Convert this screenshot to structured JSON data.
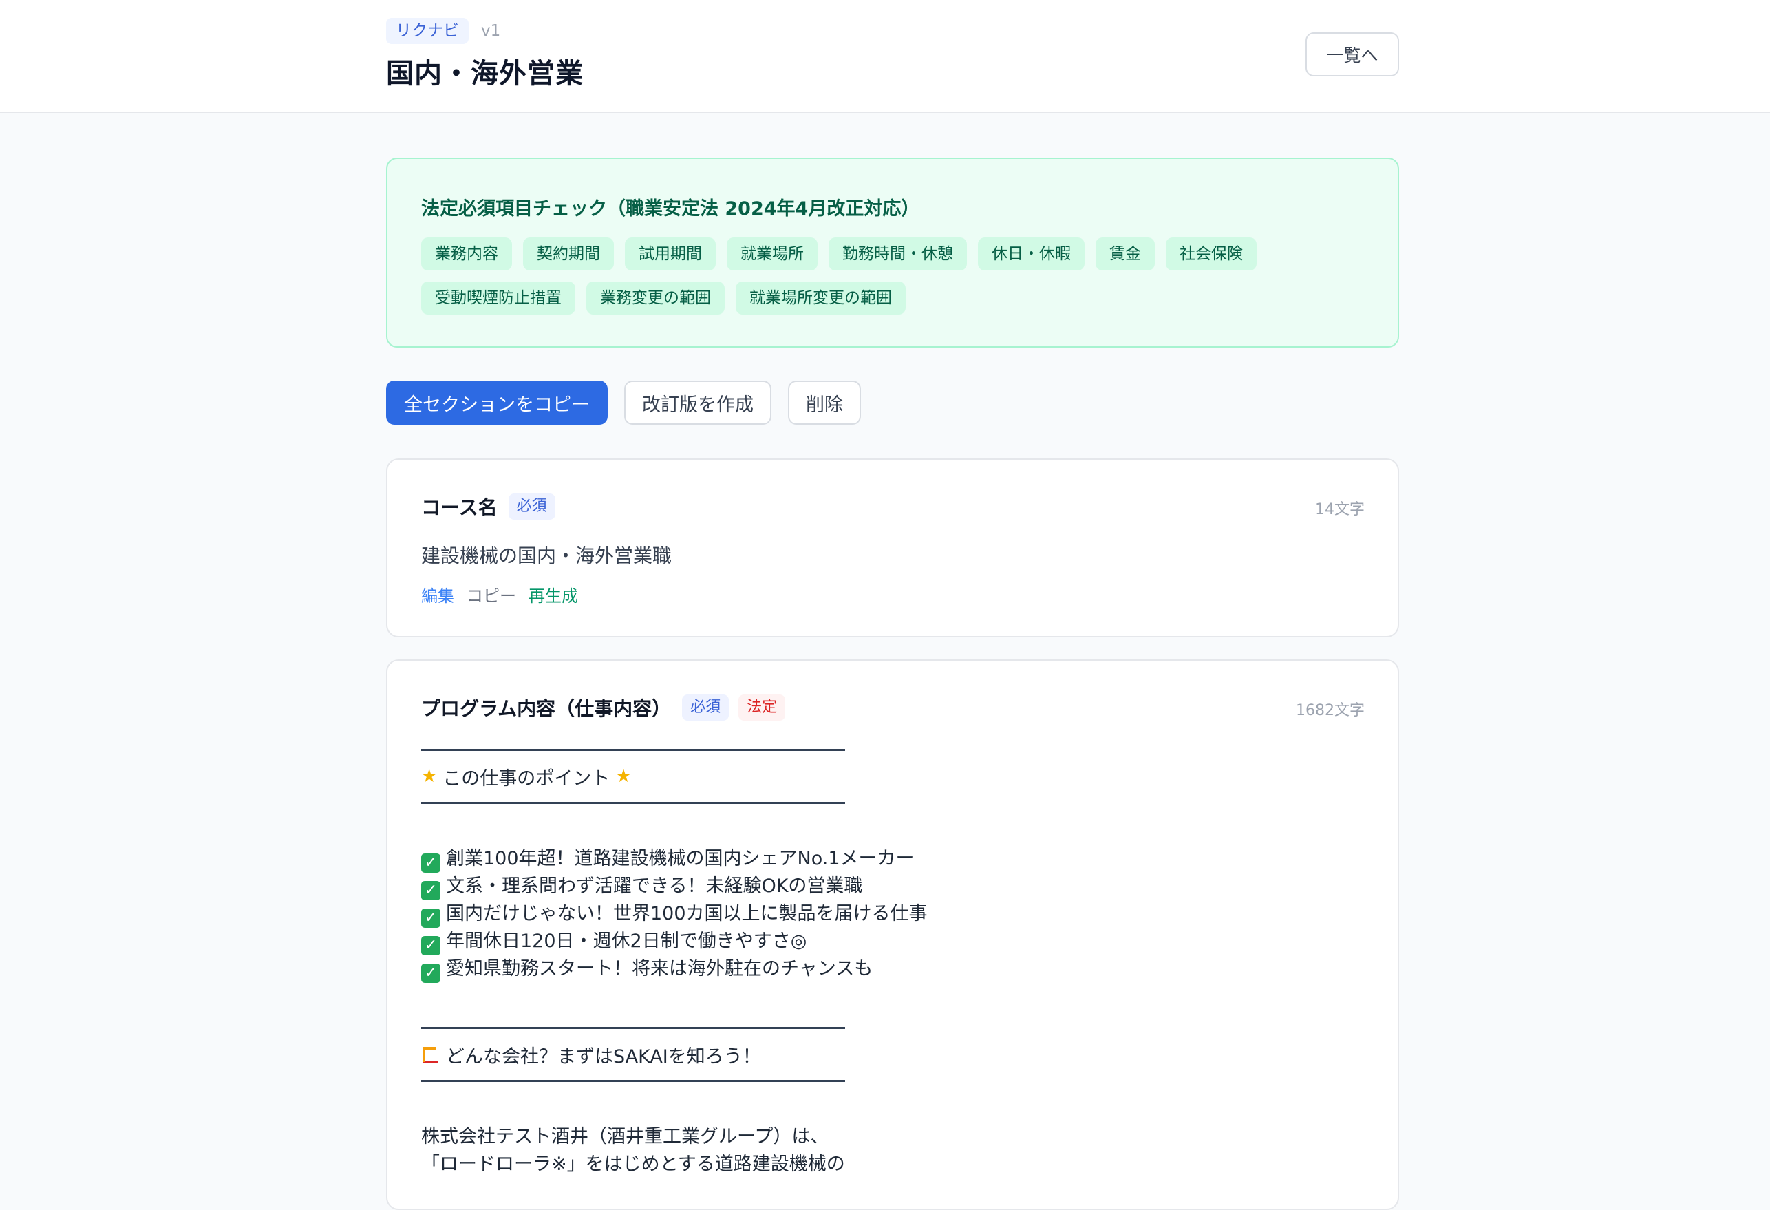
{
  "header": {
    "brand": "リクナビ",
    "version": "v1",
    "title": "国内・海外営業",
    "list_button": "一覧へ"
  },
  "legal_check": {
    "title": "法定必須項目チェック（職業安定法 2024年4月改正対応）",
    "items": [
      "業務内容",
      "契約期間",
      "試用期間",
      "就業場所",
      "勤務時間・休憩",
      "休日・休暇",
      "賃金",
      "社会保険",
      "受動喫煙防止措置",
      "業務変更の範囲",
      "就業場所変更の範囲"
    ]
  },
  "toolbar": {
    "copy_all": "全セクションをコピー",
    "create_revision": "改訂版を作成",
    "delete": "削除"
  },
  "sections": [
    {
      "title": "コース名",
      "required_tag": "必須",
      "char_count": "14文字",
      "body": "建設機械の国内・海外営業職",
      "actions": {
        "edit": "編集",
        "copy": "コピー",
        "regenerate": "再生成"
      }
    },
    {
      "title": "プログラム内容（仕事内容）",
      "required_tag": "必須",
      "legal_tag": "法定",
      "char_count": "1682文字",
      "heading1": "この仕事のポイント",
      "points": [
        "創業100年超！道路建設機械の国内シェアNo.1メーカー",
        "文系・理系問わず活躍できる！未経験OKの営業職",
        "国内だけじゃない！世界100カ国以上に製品を届ける仕事",
        "年間休日120日・週休2日制で働きやすさ◎",
        "愛知県勤務スタート！将来は海外駐在のチャンスも"
      ],
      "heading2": "どんな会社？まずはSAKAIを知ろう！",
      "paragraph": [
        "株式会社テスト酒井（酒井重工業グループ）は、",
        "「ロードローラ※」をはじめとする道路建設機械の"
      ]
    }
  ],
  "icons": {
    "star": "star-icon",
    "check": "check-mark-icon",
    "crane": "crane-icon"
  }
}
